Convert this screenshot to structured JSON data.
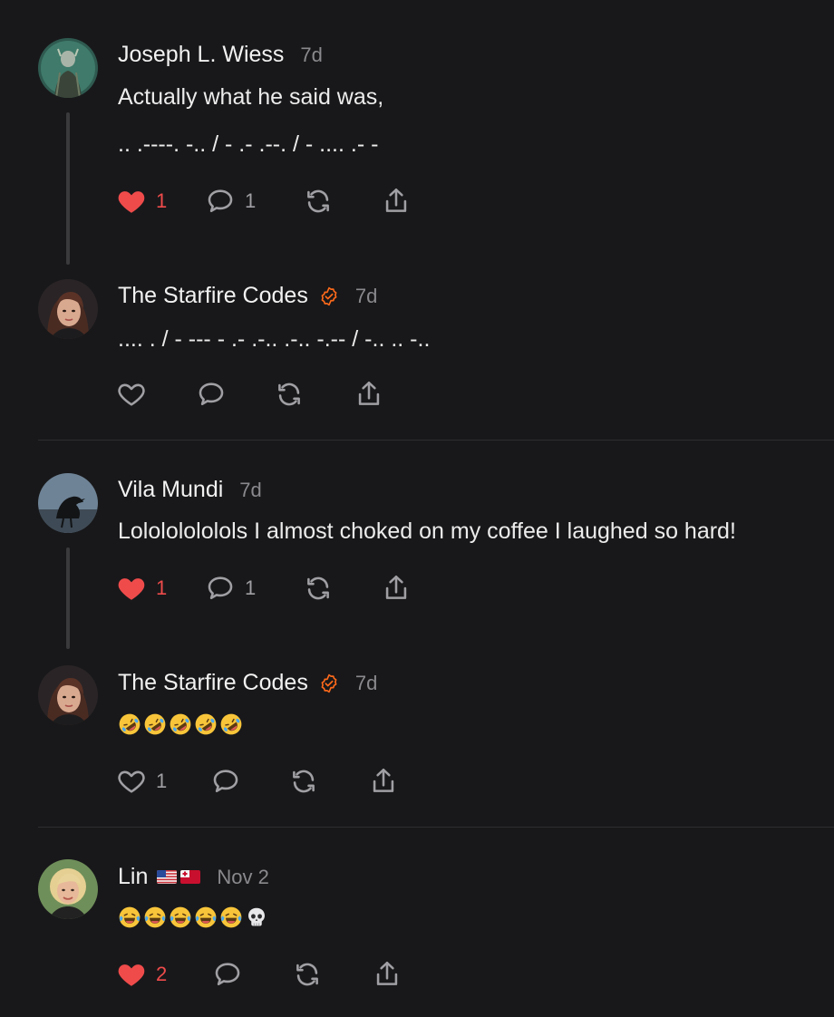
{
  "comments": [
    {
      "author": "Joseph L. Wiess",
      "time": "7d",
      "lines": [
        "Actually what he said was,",
        ".. .----. -.. / - .- .--. / - .... .- -"
      ],
      "likes": "1",
      "liked": true,
      "replies": "1"
    },
    {
      "author": "The Starfire Codes",
      "time": "7d",
      "verified": true,
      "lines": [
        ".... . / - --- - .- .-.. .-.. -.-- / -.. .. -.."
      ],
      "likes": "",
      "liked": false,
      "replies": ""
    },
    {
      "author": "Vila Mundi",
      "time": "7d",
      "lines": [
        "Lolololololols I almost choked on my coffee I laughed so hard!"
      ],
      "likes": "1",
      "liked": true,
      "replies": "1"
    },
    {
      "author": "The Starfire Codes",
      "time": "7d",
      "verified": true,
      "emoji": [
        "rolling-on-floor-laughing",
        "rolling-on-floor-laughing",
        "rolling-on-floor-laughing",
        "rolling-on-floor-laughing",
        "rolling-on-floor-laughing"
      ],
      "likes": "1",
      "liked": false,
      "replies": ""
    },
    {
      "author": "Lin",
      "time": "Nov 2",
      "flags": [
        "us-flag",
        "tonga-flag"
      ],
      "emoji": [
        "tears-of-joy",
        "tears-of-joy",
        "tears-of-joy",
        "tears-of-joy",
        "tears-of-joy",
        "skull"
      ],
      "likes": "2",
      "liked": true,
      "replies": ""
    }
  ],
  "colors": {
    "background": "#18181a",
    "like_red": "#ef4b4b",
    "verified_orange": "#ff6a1a",
    "muted": "#8a8a8e"
  }
}
